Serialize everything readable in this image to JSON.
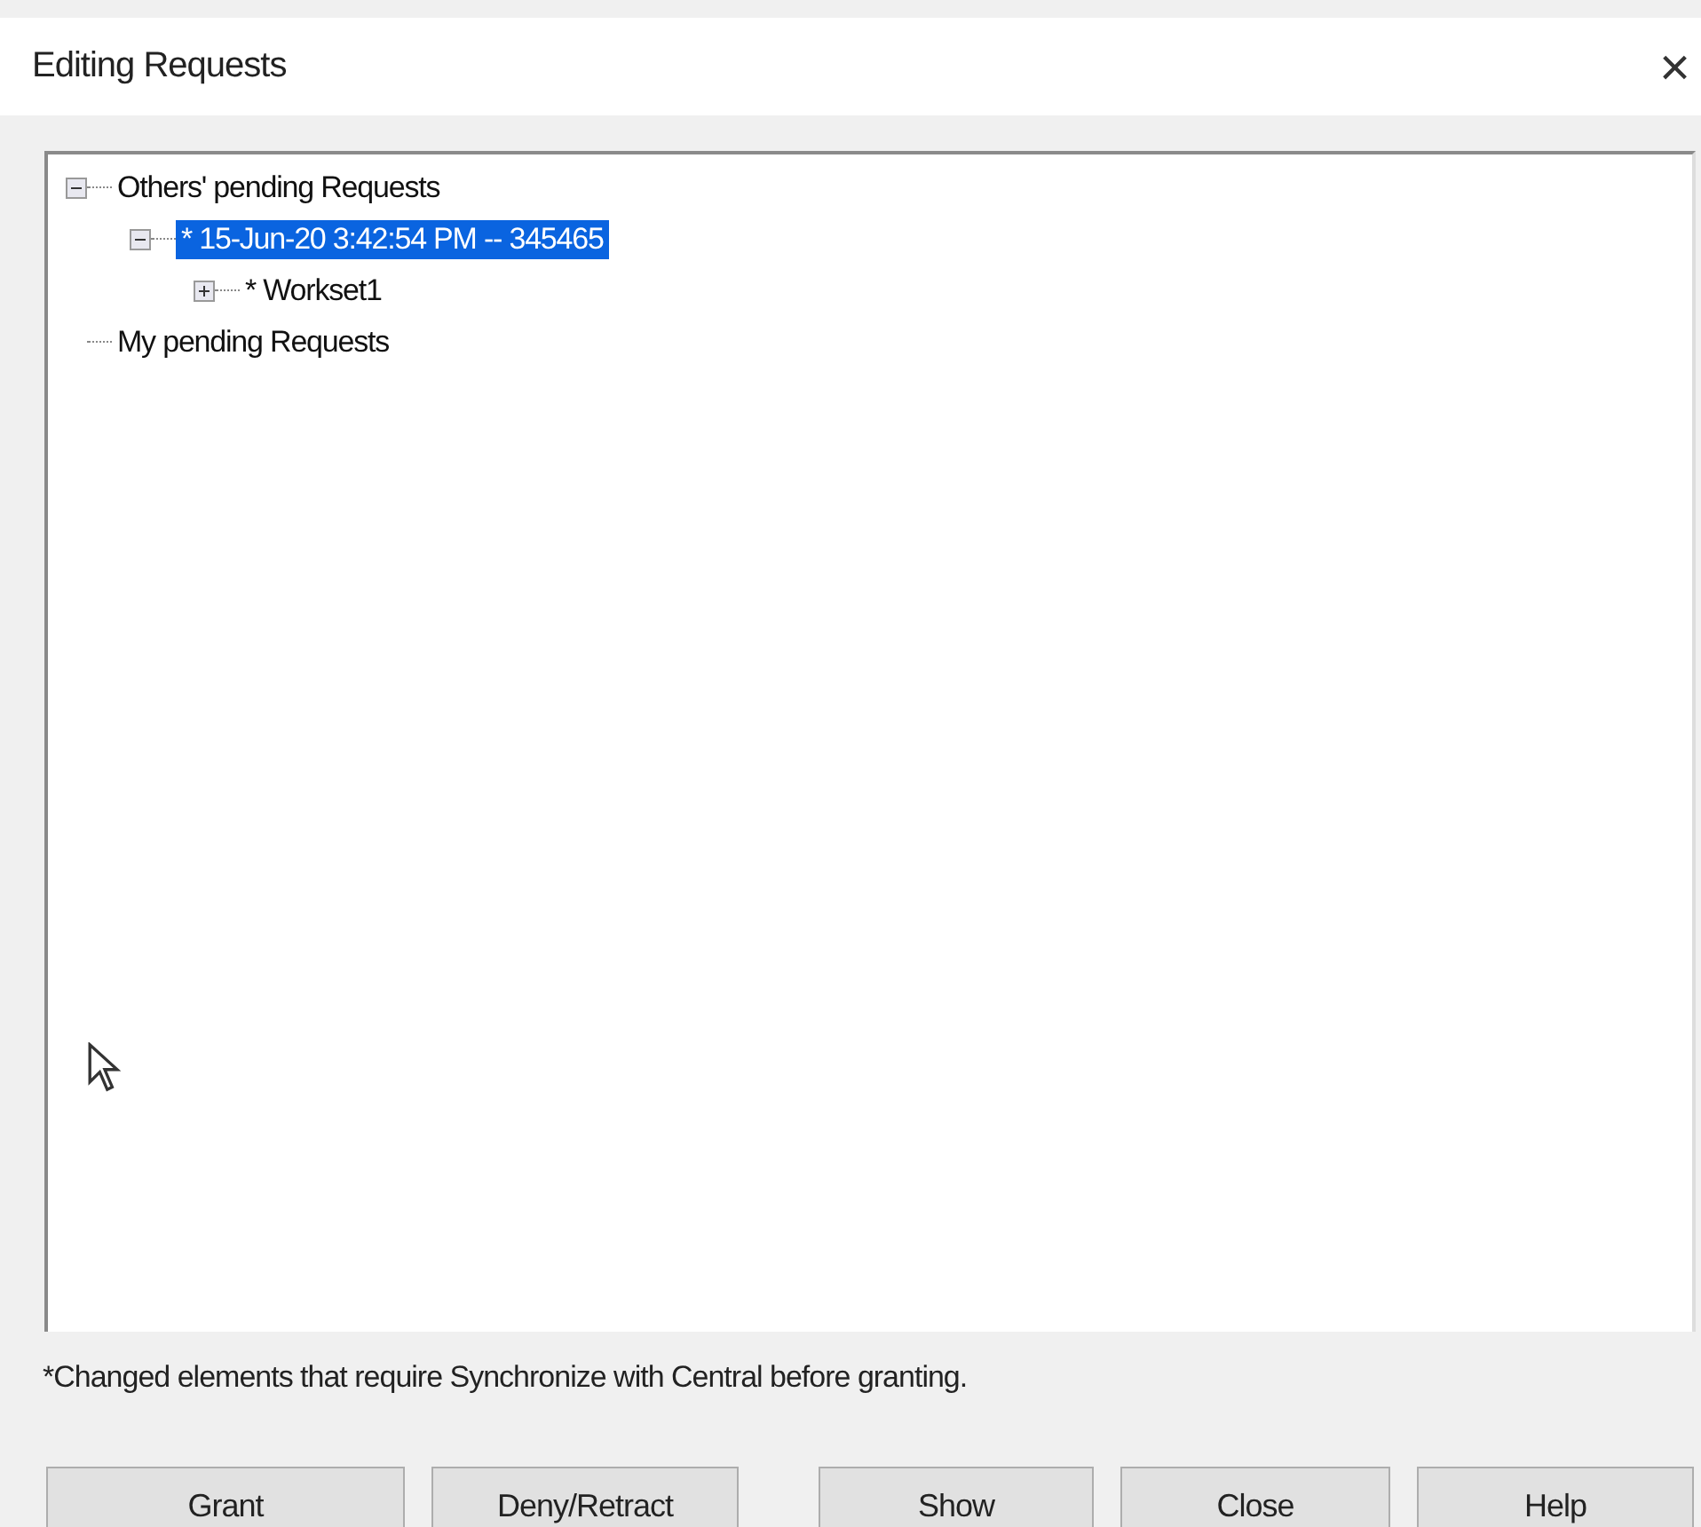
{
  "window": {
    "title": "Editing Requests",
    "close": "×"
  },
  "tree": [
    {
      "label": "Others' pending Requests",
      "kind": "node",
      "expanded": true,
      "selected": false,
      "children": [
        {
          "label": "* 15-Jun-20 3:42:54 PM -- 345465",
          "kind": "node",
          "expanded": true,
          "selected": true,
          "children": [
            {
              "label": "* Workset1",
              "kind": "node",
              "expanded": false,
              "selected": false
            }
          ]
        }
      ]
    },
    {
      "label": "My pending Requests",
      "kind": "leaf",
      "selected": false
    }
  ],
  "footnote": "*Changed elements that require Synchronize with Central before granting.",
  "buttons": [
    "Grant",
    "Deny/Retract",
    "Show",
    "Close",
    "Help"
  ]
}
